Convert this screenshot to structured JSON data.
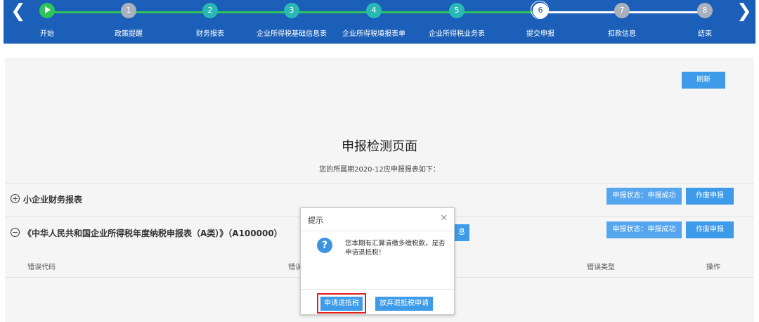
{
  "stepper": {
    "steps": [
      {
        "num": "",
        "label": "开始"
      },
      {
        "num": "1",
        "label": "政策提醒"
      },
      {
        "num": "2",
        "label": "财务报表"
      },
      {
        "num": "3",
        "label": "企业所得税基础信息表"
      },
      {
        "num": "4",
        "label": "企业所得税填报表单"
      },
      {
        "num": "5",
        "label": "企业所得税业务表"
      },
      {
        "num": "6",
        "label": "提交申报"
      },
      {
        "num": "7",
        "label": "扣款信息"
      },
      {
        "num": "8",
        "label": "结束"
      }
    ],
    "current_step": 6,
    "prev_icon": "chevron-left-icon",
    "next_icon": "chevron-right-icon"
  },
  "main": {
    "refresh_label": "刷新",
    "title": "申报检测页面",
    "subtitle": "您的所属期2020-12应申报报表如下：",
    "reports": [
      {
        "name": "小企业财务报表",
        "status_label": "申报状态：申报成功",
        "void_label": "作废申报"
      },
      {
        "name": "《中华人民共和国企业所得税年度纳税申报表（A类）》（A100000）",
        "status_label": "申报状态：申报成功",
        "void_label": "作废申报",
        "partial_button_text": "息"
      }
    ],
    "table_headers": [
      "错误代码",
      "错误",
      "错误类型",
      "操作"
    ]
  },
  "modal": {
    "title": "提示",
    "close_icon": "close-icon",
    "question_icon": "question-icon",
    "message": "您本期有汇算清缴多缴税款，是否申请退抵税！",
    "apply_label": "申请退抵税",
    "abandon_label": "放弃退抵税申请"
  },
  "colors": {
    "header_bg": "#1b5fb8",
    "done_green": "#2fc45a",
    "teal": "#2ab8b4",
    "button_blue": "#3d9be9",
    "highlight_red": "#e02020"
  }
}
